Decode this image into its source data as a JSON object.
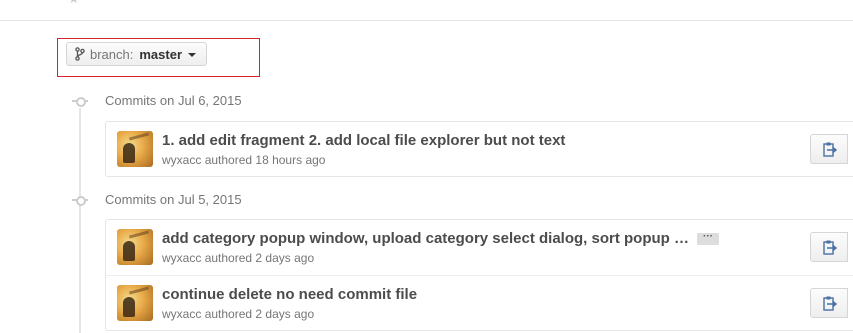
{
  "branch_selector": {
    "label": "branch:",
    "name": "master"
  },
  "commit_groups": [
    {
      "header": "Commits on Jul 6, 2015",
      "commits": [
        {
          "title": "1. add edit fragment 2. add local file explorer but not text",
          "author": "wyxacc",
          "authored_label": "authored",
          "time": "18 hours ago",
          "has_ellipsis": false
        }
      ]
    },
    {
      "header": "Commits on Jul 5, 2015",
      "commits": [
        {
          "title": "add category popup window, upload category select dialog, sort popup …",
          "author": "wyxacc",
          "authored_label": "authored",
          "time": "2 days ago",
          "has_ellipsis": true,
          "ellipsis_label": "···"
        },
        {
          "title": "continue delete no need commit file",
          "author": "wyxacc",
          "authored_label": "authored",
          "time": "2 days ago",
          "has_ellipsis": false
        }
      ]
    }
  ],
  "colors": {
    "highlight_box": "#d9232a",
    "timeline": "#e5e5e5",
    "title_text": "#4c4c4c",
    "meta_text": "#767676"
  },
  "icons": {
    "branch": "git-branch-icon",
    "copy": "clipboard-icon",
    "caret": "chevron-down-icon"
  }
}
